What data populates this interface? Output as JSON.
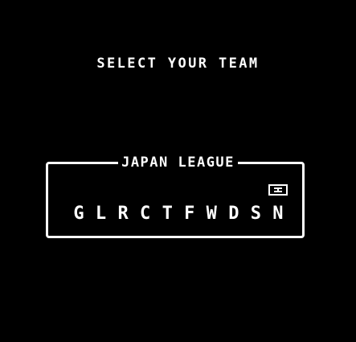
{
  "screen": {
    "title": "SELECT YOUR TEAM",
    "background_color": "#000000",
    "foreground_color": "#ffffff"
  },
  "league": {
    "name": "JAPAN LEAGUE",
    "teams": [
      {
        "code": "G",
        "selected": false
      },
      {
        "code": "L",
        "selected": false
      },
      {
        "code": "R",
        "selected": false
      },
      {
        "code": "C",
        "selected": false
      },
      {
        "code": "T",
        "selected": false
      },
      {
        "code": "F",
        "selected": false
      },
      {
        "code": "W",
        "selected": false
      },
      {
        "code": "D",
        "selected": false
      },
      {
        "code": "S",
        "selected": false
      },
      {
        "code": "N",
        "selected": true
      }
    ],
    "cursor_icon": "selection-cursor-icon"
  }
}
